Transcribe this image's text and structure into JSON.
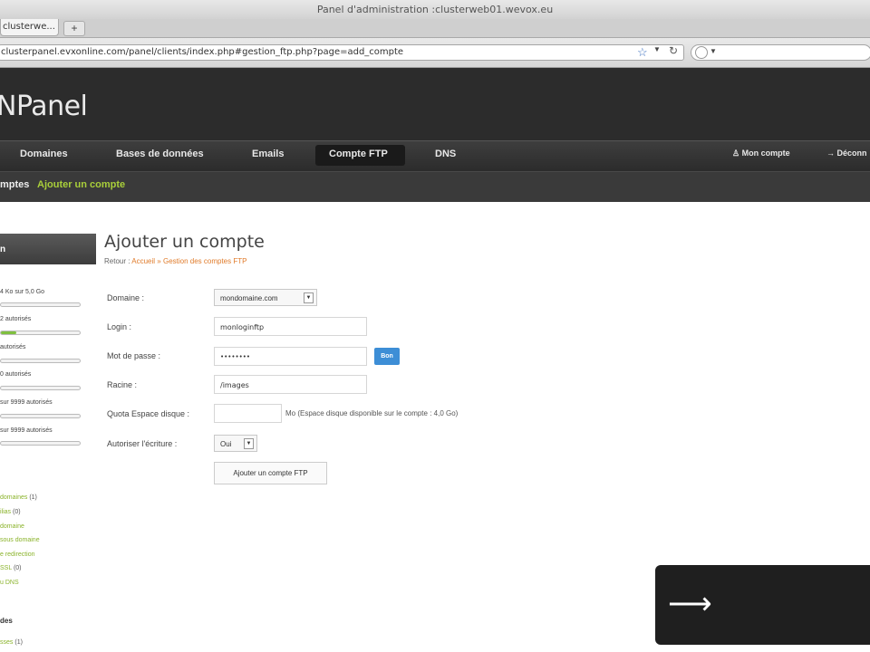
{
  "browser": {
    "window_title": "Panel d'administration :clusterweb01.wevox.eu",
    "tab_label": "clusterwe...",
    "url": "clusterpanel.evxonline.com/panel/clients/index.php#gestion_ftp.php?page=add_compte"
  },
  "app": {
    "logo": "NPanel",
    "nav": [
      {
        "label": "Domaines"
      },
      {
        "label": "Bases de données"
      },
      {
        "label": "Emails"
      },
      {
        "label": "Compte FTP",
        "active": true
      },
      {
        "label": "DNS"
      }
    ],
    "account": "Mon compte",
    "logout": "Déconn",
    "subnav": [
      {
        "label": "mptes"
      },
      {
        "label": "Ajouter un compte"
      }
    ]
  },
  "sidebar": {
    "head": "n",
    "usage": [
      {
        "text": "4 Ko sur 5,0 Go",
        "fill": 0
      },
      {
        "text": "2 autorisés",
        "fill": 0.2
      },
      {
        "text": "autorisés",
        "fill": 0
      },
      {
        "text": "0 autorisés",
        "fill": 0
      },
      {
        "text": "sur 9999 autorisés",
        "fill": 0
      },
      {
        "text": "sur 9999 autorisés",
        "fill": 0
      }
    ],
    "links": [
      {
        "label": "domaines",
        "count": "(1)"
      },
      {
        "label": "ilias",
        "count": "(0)"
      },
      {
        "label": "domaine",
        "count": ""
      },
      {
        "label": "sous domaine",
        "count": ""
      },
      {
        "label": "e redirection",
        "count": ""
      },
      {
        "label": "SSL",
        "count": "(0)"
      },
      {
        "label": "u DNS",
        "count": ""
      }
    ],
    "section2_title": "des",
    "section2_link": {
      "label": "sses",
      "count": "(1)"
    }
  },
  "main": {
    "title": "Ajouter un compte",
    "breadcrumb": {
      "prefix": "Retour :",
      "home": "Accueil",
      "sep": "»",
      "current": "Gestion des comptes FTP"
    },
    "form": {
      "domain_label": "Domaine :",
      "domain_value": "mondomaine.com",
      "login_label": "Login :",
      "login_value": "monloginftp",
      "password_label": "Mot de passe :",
      "password_value": "••••••••",
      "password_button": "Bon",
      "root_label": "Racine :",
      "root_value": "/images",
      "quota_label": "Quota Espace disque :",
      "quota_value": "",
      "quota_note": "Mo (Espace disque disponible sur le compte : 4,0 Go)",
      "write_label": "Autoriser l'écriture :",
      "write_value": "Oui",
      "submit": "Ajouter un compte FTP"
    }
  },
  "overlay": {
    "icon": "arrow-right-icon"
  }
}
